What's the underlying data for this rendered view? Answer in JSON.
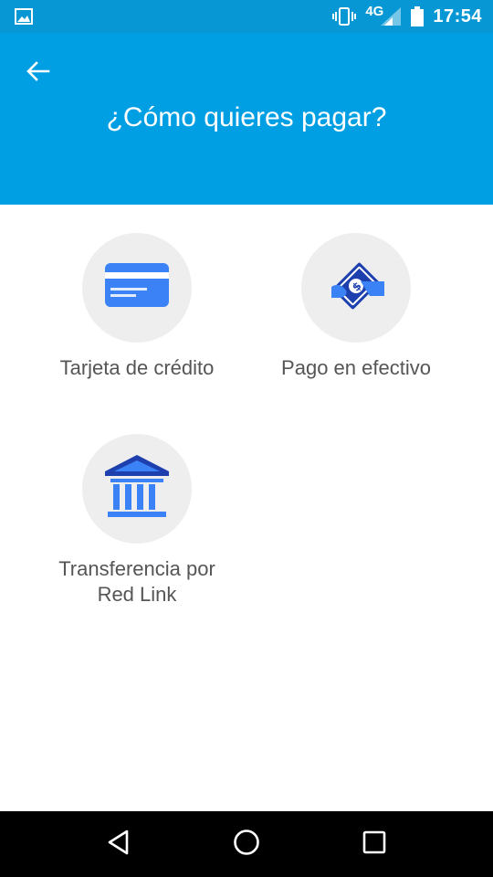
{
  "status_bar": {
    "network_label": "4G",
    "time": "17:54",
    "icons": [
      "image-notification-icon",
      "vibrate-icon",
      "signal-icon",
      "battery-icon"
    ]
  },
  "header": {
    "title": "¿Cómo quieres pagar?",
    "back_icon": "arrow-back-icon",
    "background_color": "#009ee3"
  },
  "payment_options": [
    {
      "label": "Tarjeta de crédito",
      "icon": "credit-card-icon"
    },
    {
      "label": "Pago en efectivo",
      "icon": "cash-payment-icon"
    },
    {
      "label": "Transferencia por\nRed Link",
      "icon": "bank-icon"
    }
  ],
  "nav_bar": {
    "icons": [
      "nav-back-icon",
      "nav-home-icon",
      "nav-recents-icon"
    ]
  },
  "colors": {
    "accent": "#009ee3",
    "status_bar": "#0797d4",
    "icon_blue": "#3b82f6",
    "circle_bg": "#eeeeee"
  }
}
